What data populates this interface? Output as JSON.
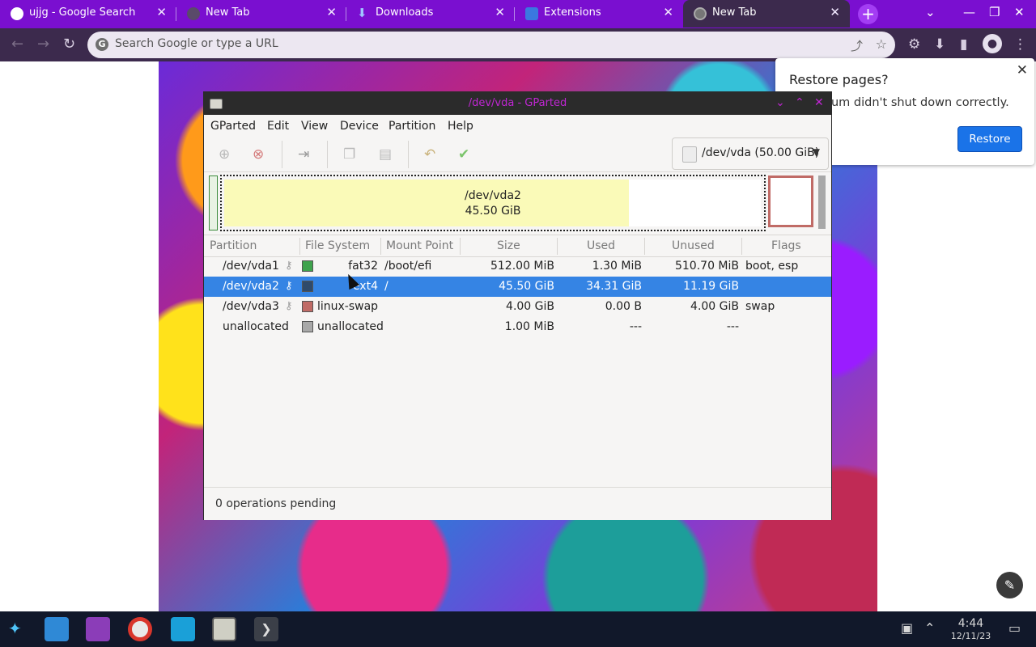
{
  "chrome": {
    "tabs": [
      {
        "label": "ujjg - Google Search",
        "icon": "google-icon"
      },
      {
        "label": "New Tab",
        "icon": "newtab-icon"
      },
      {
        "label": "Downloads",
        "icon": "download-icon"
      },
      {
        "label": "Extensions",
        "icon": "puzzle-icon"
      },
      {
        "label": "New Tab",
        "icon": "chrome-icon",
        "active": true
      }
    ],
    "close_glyph": "✕",
    "new_tab_glyph": "+",
    "omnibox_placeholder": "Search Google or type a URL",
    "accent": "#7a0fd0"
  },
  "restore_popup": {
    "title": "Restore pages?",
    "message": "Chromium didn't shut down correctly.",
    "button": "Restore"
  },
  "gparted": {
    "title": "/dev/vda - GParted",
    "menu": [
      "GParted",
      "Edit",
      "View",
      "Device",
      "Partition",
      "Help"
    ],
    "device": "/dev/vda (50.00 GiB)",
    "disk_map": {
      "name": "/dev/vda2",
      "size": "45.50 GiB"
    },
    "columns": [
      "Partition",
      "File System",
      "Mount Point",
      "Size",
      "Used",
      "Unused",
      "Flags"
    ],
    "rows": [
      {
        "partition": "/dev/vda1",
        "fs": "fat32",
        "fs_color": "#3fa34d",
        "mount": "/boot/efi",
        "size": "512.00 MiB",
        "used": "1.30 MiB",
        "unused": "510.70 MiB",
        "flags": "boot, esp"
      },
      {
        "partition": "/dev/vda2",
        "fs": "ext4",
        "fs_color": "#2f4a6b",
        "mount": "/",
        "size": "45.50 GiB",
        "used": "34.31 GiB",
        "unused": "11.19 GiB",
        "flags": ""
      },
      {
        "partition": "/dev/vda3",
        "fs": "linux-swap",
        "fs_color": "#c06b66",
        "mount": "",
        "size": "4.00 GiB",
        "used": "0.00 B",
        "unused": "4.00 GiB",
        "flags": "swap"
      },
      {
        "partition": "unallocated",
        "fs": "unallocated",
        "fs_color": "#a8a8a8",
        "mount": "",
        "size": "1.00 MiB",
        "used": "---",
        "unused": "---",
        "flags": ""
      }
    ],
    "status": "0 operations pending"
  },
  "taskbar": {
    "time": "4:44",
    "date": "12/11/23"
  }
}
